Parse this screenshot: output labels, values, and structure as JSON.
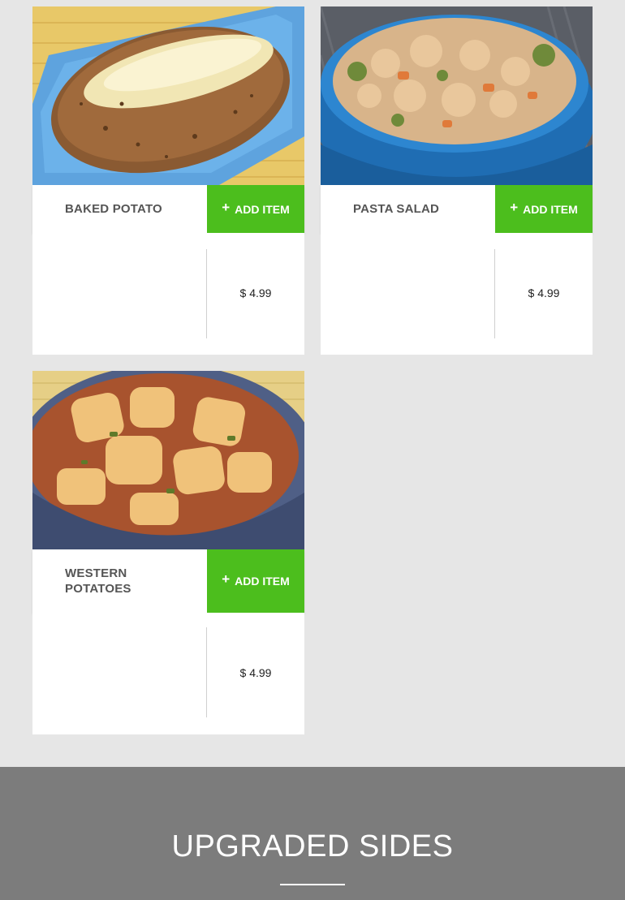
{
  "menu": {
    "add_label": "ADD ITEM",
    "plus_glyph": "+",
    "items": [
      {
        "name": "BAKED POTATO",
        "price": "$ 4.99",
        "image": "baked-potato-photo"
      },
      {
        "name": "PASTA SALAD",
        "price": "$ 4.99",
        "image": "pasta-salad-photo"
      },
      {
        "name": "WESTERN POTATOES",
        "price": "$ 4.99",
        "image": "western-potatoes-photo"
      }
    ]
  },
  "section": {
    "title": "UPGRADED SIDES"
  },
  "colors": {
    "accent": "#4cbe1d",
    "page_bg": "#e6e6e6",
    "footer_bg": "#7c7c7c"
  }
}
